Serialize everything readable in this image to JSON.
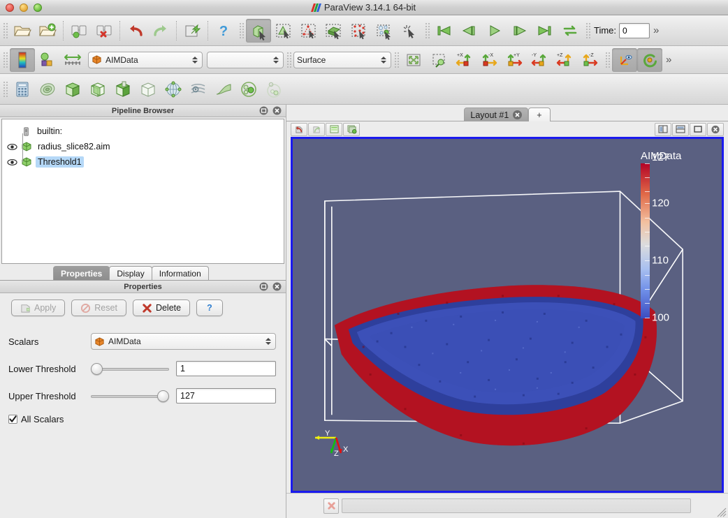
{
  "window": {
    "title": "ParaView 3.14.1 64-bit",
    "logo_colors": [
      "#d93025",
      "#1e9e3e",
      "#2b5fd9"
    ],
    "traffic_lights": [
      "close",
      "minimize",
      "zoom"
    ]
  },
  "main_toolbar": {
    "items": [
      {
        "name": "open-file-icon",
        "tooltip": "Open"
      },
      {
        "name": "open-recent-icon",
        "tooltip": "Recent Files"
      },
      {
        "name": "connect-server-icon",
        "tooltip": "Connect"
      },
      {
        "name": "disconnect-server-icon",
        "tooltip": "Disconnect"
      },
      {
        "name": "undo-icon",
        "tooltip": "Undo"
      },
      {
        "name": "redo-icon",
        "tooltip": "Redo"
      },
      {
        "name": "save-state-icon",
        "tooltip": "Save State"
      },
      {
        "name": "help-icon",
        "tooltip": "Help"
      }
    ],
    "selection_items": [
      {
        "name": "select-cells-through-icon",
        "active": true
      },
      {
        "name": "select-points-on-icon",
        "active": false
      },
      {
        "name": "select-points-through-icon",
        "active": false
      },
      {
        "name": "select-surface-cells-icon",
        "active": false
      },
      {
        "name": "select-frustum-cells-icon",
        "active": false
      },
      {
        "name": "select-frustum-points-icon",
        "active": false
      },
      {
        "name": "select-block-icon",
        "active": false
      }
    ],
    "vcr": [
      {
        "name": "first-frame-icon"
      },
      {
        "name": "previous-frame-icon"
      },
      {
        "name": "play-icon"
      },
      {
        "name": "next-frame-icon"
      },
      {
        "name": "last-frame-icon"
      },
      {
        "name": "loop-icon"
      }
    ],
    "time_label": "Time:",
    "time_value": "0",
    "overflow_chevron": "»"
  },
  "representation_toolbar": {
    "colormap_icon": "color-map-icon",
    "edit_colormap_icon": "edit-color-map-icon",
    "rescale_icon": "rescale-range-icon",
    "array_selector": {
      "label": "AIMData",
      "icon": "point-data-icon"
    },
    "component_selector": {
      "label": ""
    },
    "representation_selector": {
      "label": "Surface"
    },
    "camera_buttons": [
      {
        "name": "reset-camera-icon"
      },
      {
        "name": "zoom-to-box-icon"
      },
      {
        "name": "camera-plus-x-icon",
        "label": "+X"
      },
      {
        "name": "camera-minus-x-icon",
        "label": "-X"
      },
      {
        "name": "camera-plus-y-icon",
        "label": "+Y"
      },
      {
        "name": "camera-minus-y-icon",
        "label": "-Y"
      },
      {
        "name": "camera-plus-z-icon",
        "label": "+Z"
      },
      {
        "name": "camera-minus-z-icon",
        "label": "-Z"
      },
      {
        "name": "show-center-axes-icon",
        "active": true
      },
      {
        "name": "reset-center-rotation-icon",
        "active": true
      }
    ],
    "overflow_chevron": "»"
  },
  "filters_toolbar": {
    "items": [
      {
        "name": "calculator-icon"
      },
      {
        "name": "contour-icon"
      },
      {
        "name": "clip-icon"
      },
      {
        "name": "slice-icon"
      },
      {
        "name": "threshold-icon"
      },
      {
        "name": "extract-subset-icon"
      },
      {
        "name": "glyph-icon"
      },
      {
        "name": "stream-tracer-icon"
      },
      {
        "name": "warp-icon"
      },
      {
        "name": "group-datasets-icon"
      },
      {
        "name": "extract-level-icon"
      }
    ]
  },
  "pipeline_browser": {
    "title": "Pipeline Browser",
    "undock_icon": "undock-icon",
    "close_icon": "close-icon",
    "items": [
      {
        "label": "builtin:",
        "icon": "server-icon",
        "has_eye": false,
        "selected": false
      },
      {
        "label": "radius_slice82.aim",
        "icon": "source-icon",
        "has_eye": true,
        "selected": false
      },
      {
        "label": "Threshold1",
        "icon": "source-icon",
        "has_eye": true,
        "selected": true
      }
    ]
  },
  "panel_tabs": [
    {
      "label": "Properties",
      "active": true
    },
    {
      "label": "Display",
      "active": false
    },
    {
      "label": "Information",
      "active": false
    }
  ],
  "properties_panel": {
    "title": "Properties",
    "undock_icon": "undock-icon",
    "close_icon": "close-icon",
    "buttons": [
      {
        "label": "Apply",
        "name": "apply-button",
        "icon": "apply-icon",
        "enabled": false
      },
      {
        "label": "Reset",
        "name": "reset-button",
        "icon": "reset-icon",
        "enabled": false
      },
      {
        "label": "Delete",
        "name": "delete-button",
        "icon": "delete-icon",
        "enabled": true
      },
      {
        "label": "?",
        "name": "help-button",
        "icon": "question-icon",
        "enabled": true
      }
    ],
    "scalars_label": "Scalars",
    "scalars_value": "AIMData",
    "scalars_icon": "point-data-icon",
    "lower_threshold_label": "Lower Threshold",
    "lower_threshold_value": "1",
    "lower_threshold_percent": 2,
    "upper_threshold_label": "Upper Threshold",
    "upper_threshold_value": "127",
    "upper_threshold_percent": 98,
    "all_scalars_label": "All Scalars",
    "all_scalars_checked": true
  },
  "layout": {
    "tab_label": "Layout #1",
    "tab_close_icon": "close-icon",
    "new_tab_label": "+",
    "view_toolbar_left": [
      {
        "name": "undo-camera-icon"
      },
      {
        "name": "redo-camera-icon"
      },
      {
        "name": "show-color-legend-icon"
      },
      {
        "name": "rescale-to-data-icon"
      }
    ],
    "view_toolbar_right": [
      {
        "name": "split-horizontal-icon"
      },
      {
        "name": "split-vertical-icon"
      },
      {
        "name": "maximize-view-icon"
      },
      {
        "name": "close-view-icon"
      }
    ]
  },
  "render_view": {
    "background_color": "#5a6081",
    "border_color": "#1a1aee",
    "surface_colors": {
      "outer": "#b01020",
      "inner": "#3348a8"
    },
    "outline_color": "#ffffff",
    "orientation_axes": [
      {
        "label": "X",
        "color": "#e01010"
      },
      {
        "label": "Y",
        "color": "#f0f010"
      },
      {
        "label": "Z",
        "color": "#10c010"
      }
    ],
    "color_legend": {
      "title": "AIMData",
      "labels": [
        "127",
        "120",
        "110",
        "100"
      ],
      "range_min": 100,
      "range_max": 127,
      "colormap": "cool-to-warm"
    }
  },
  "status_bar": {
    "abort_icon": "abort-icon",
    "progress_text": ""
  }
}
